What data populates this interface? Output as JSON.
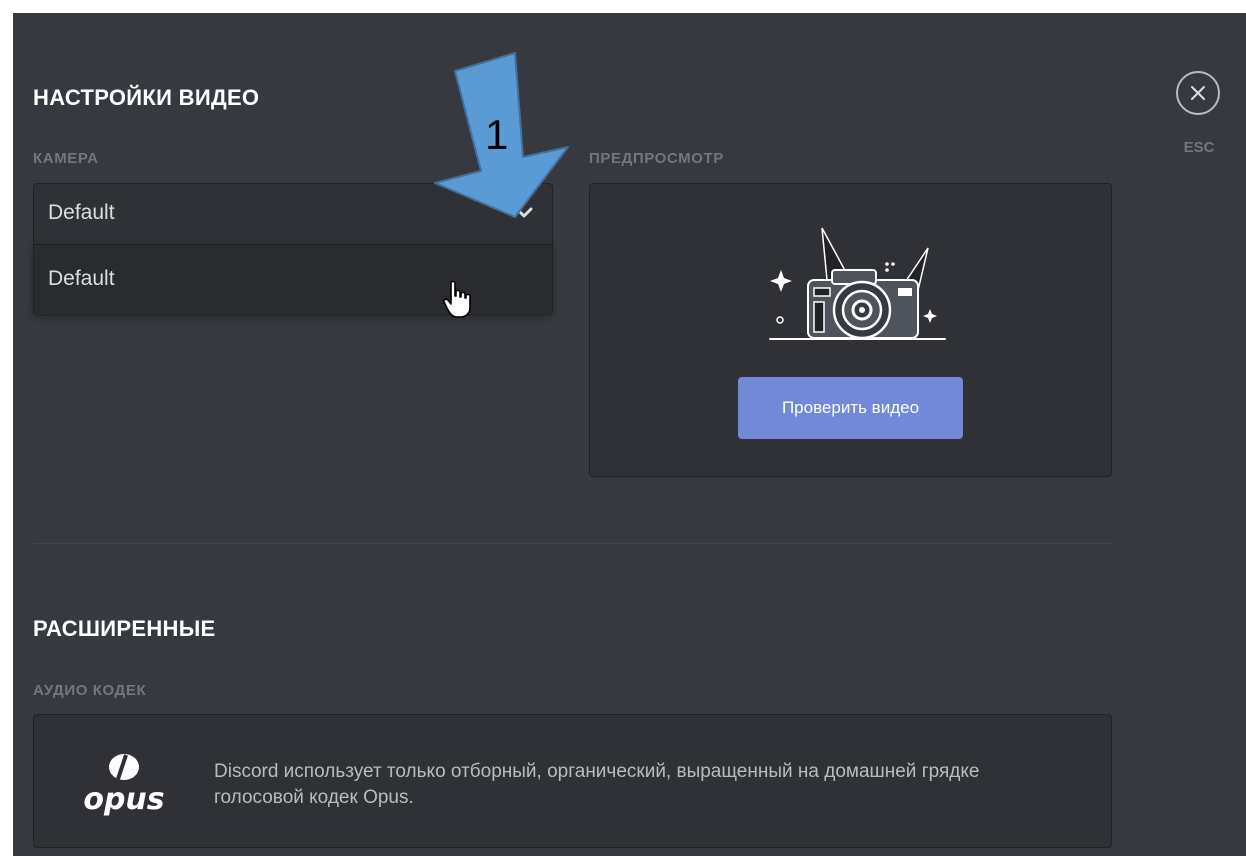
{
  "video_settings": {
    "title": "НАСТРОЙКИ ВИДЕО",
    "camera_label": "КАМЕРА",
    "camera_selected": "Default",
    "camera_options": [
      "Default"
    ],
    "preview_label": "ПРЕДПРОСМОТР",
    "test_button": "Проверить видео"
  },
  "close": {
    "esc_label": "ESC"
  },
  "advanced": {
    "title": "РАСШИРЕННЫЕ",
    "codec_label": "АУДИО КОДЕК",
    "codec_description": "Discord использует только отборный, органический, выращенный на домашней грядке голосовой кодек Opus."
  },
  "annotation": {
    "number": "1"
  },
  "colors": {
    "background": "#36393f",
    "panel": "#2f3136",
    "accent": "#7289da",
    "annotation_arrow": "#5b9bd5"
  }
}
